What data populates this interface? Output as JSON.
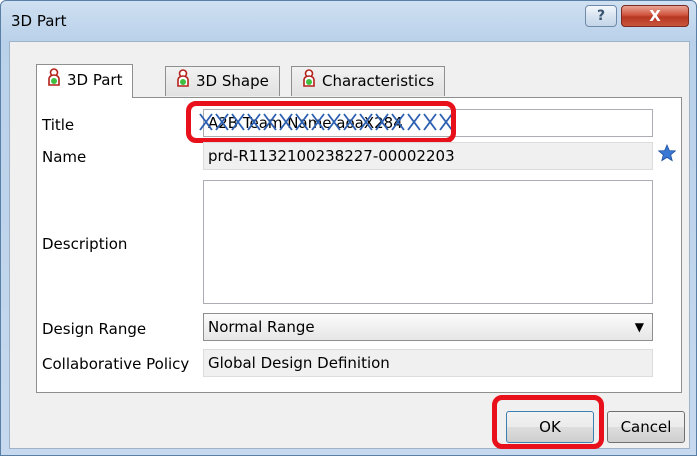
{
  "window": {
    "title": "3D Part",
    "help_label": "?",
    "close_label": "X"
  },
  "tabs": [
    {
      "label": "3D Part",
      "icon": "person-icon",
      "active": true
    },
    {
      "label": "3D Shape",
      "icon": "person-icon",
      "active": false
    },
    {
      "label": "Characteristics",
      "icon": "person-icon",
      "active": false
    }
  ],
  "form": {
    "title_label": "Title",
    "title_value": "A2B Team Name aoaX284",
    "name_label": "Name",
    "name_value": "prd-R1132100238227-00002203",
    "description_label": "Description",
    "description_value": "",
    "design_range_label": "Design Range",
    "design_range_value": "Normal Range",
    "collab_policy_label": "Collaborative Policy",
    "collab_policy_value": "Global Design Definition"
  },
  "buttons": {
    "ok": "OK",
    "cancel": "Cancel"
  },
  "colors": {
    "highlight": "#e8101a",
    "star": "#3a78d6",
    "scribble": "#2d5fb0"
  }
}
